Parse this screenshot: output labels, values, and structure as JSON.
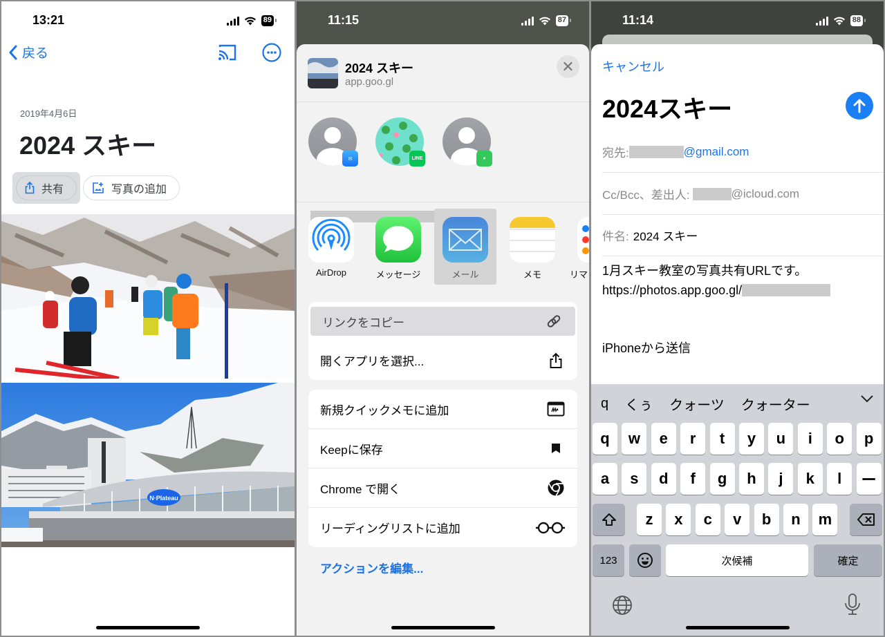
{
  "panel1": {
    "status": {
      "time": "13:21",
      "battery": "89"
    },
    "nav": {
      "back_label": "戻る",
      "back_icon": "chevron-left-icon",
      "cast_icon": "cast-icon",
      "more_icon": "more-horizontal-icon"
    },
    "album": {
      "date": "2019年4月6日",
      "title": "2024 スキー",
      "share_label": "共有",
      "add_photos_label": "写真の追加"
    },
    "photos": [
      {
        "description": "children skiing on slope with mountains"
      },
      {
        "description": "N-Plateau ski resort building with snowy mountains"
      }
    ],
    "photo_sign_text": "N·Plateau"
  },
  "panel2": {
    "status": {
      "time": "11:15",
      "battery": "87"
    },
    "share_header": {
      "title": "2024 スキー",
      "subtitle": "app.goo.gl",
      "close_icon": "close-icon"
    },
    "people": [
      {
        "badge": "mail",
        "badge_color": "#1a8cff"
      },
      {
        "badge": "LINE",
        "badge_color": "#06c755"
      },
      {
        "badge": "messages",
        "badge_color": "#34c759"
      }
    ],
    "apps": [
      {
        "label": "AirDrop",
        "icon": "airdrop-icon"
      },
      {
        "label": "メッセージ",
        "icon": "messages-icon"
      },
      {
        "label": "メール",
        "icon": "mail-icon",
        "selected": true
      },
      {
        "label": "メモ",
        "icon": "notes-icon"
      },
      {
        "label": "リマ",
        "icon": "reminders-icon"
      }
    ],
    "actions_group1": [
      {
        "label": "リンクをコピー",
        "icon": "link-icon",
        "highlighted": true
      },
      {
        "label": "開くアプリを選択...",
        "icon": "share-icon"
      }
    ],
    "actions_group2": [
      {
        "label": "新規クイックメモに追加",
        "icon": "quick-note-icon"
      },
      {
        "label": "Keepに保存",
        "icon": "bookmark-icon"
      },
      {
        "label": "Chrome で開く",
        "icon": "chrome-icon"
      },
      {
        "label": "リーディングリストに追加",
        "icon": "glasses-icon"
      }
    ],
    "edit_actions_label": "アクションを編集..."
  },
  "panel3": {
    "status": {
      "time": "11:14",
      "battery": "88"
    },
    "mail": {
      "cancel_label": "キャンセル",
      "title": "2024スキー",
      "to_label": "宛先:",
      "to_domain": "@gmail.com",
      "cc_label": "Cc/Bcc、差出人:",
      "cc_domain": "@icloud.com",
      "subject_label": "件名:",
      "subject_value": "2024 スキー",
      "body_line1": "1月スキー教室の写真共有URLです。",
      "body_line2": "https://photos.app.goo.gl/",
      "signature": "iPhoneから送信"
    },
    "keyboard": {
      "candidates": [
        "q",
        "くぅ",
        "クォーツ",
        "クォーター"
      ],
      "row1": [
        "q",
        "w",
        "e",
        "r",
        "t",
        "y",
        "u",
        "i",
        "o",
        "p"
      ],
      "row2": [
        "a",
        "s",
        "d",
        "f",
        "g",
        "h",
        "j",
        "k",
        "l",
        "ー"
      ],
      "row3": [
        "z",
        "x",
        "c",
        "v",
        "b",
        "n",
        "m"
      ],
      "numbers_label": "123",
      "space_label": "次候補",
      "confirm_label": "確定"
    }
  }
}
